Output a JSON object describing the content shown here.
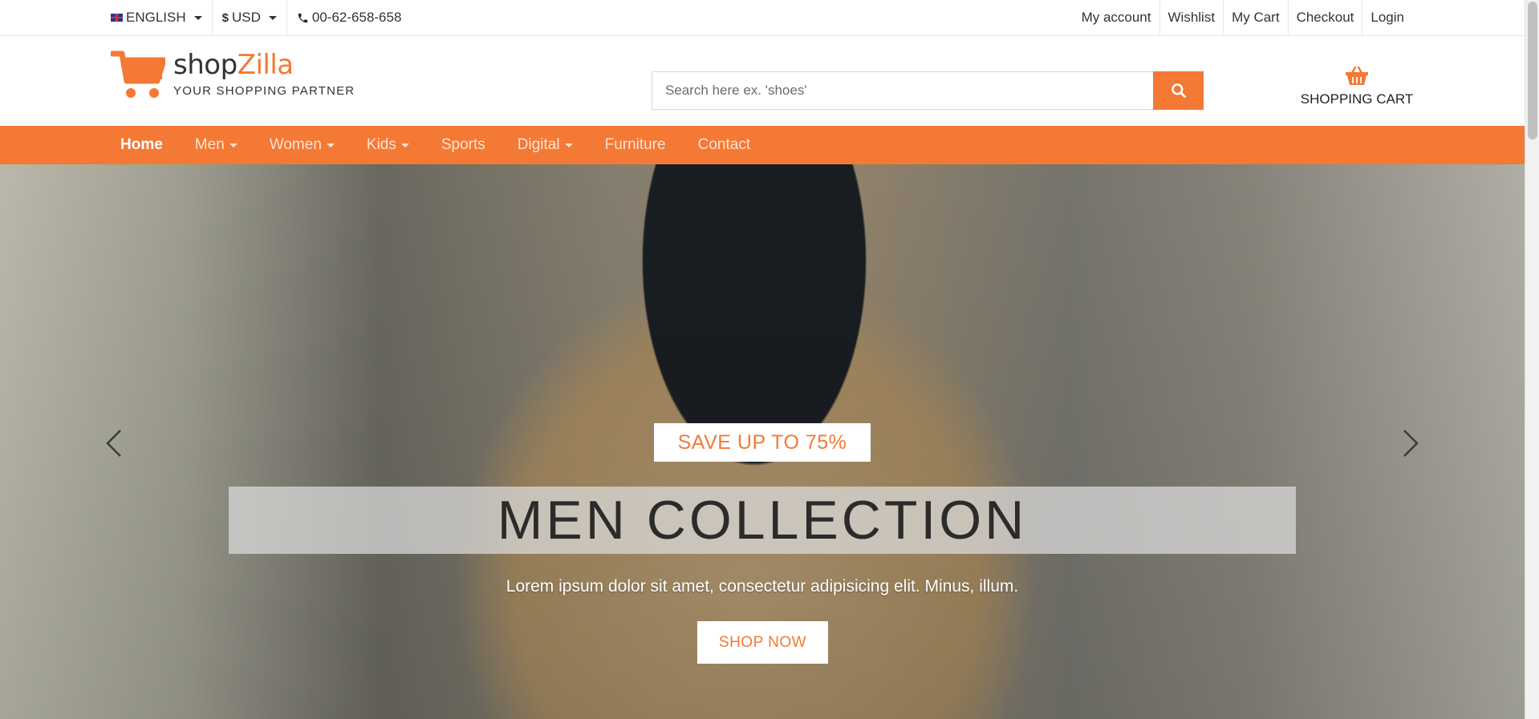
{
  "topbar": {
    "language": "ENGLISH",
    "currency": "USD",
    "phone": "00-62-658-658",
    "links": [
      "My account",
      "Wishlist",
      "My Cart",
      "Checkout",
      "Login"
    ]
  },
  "header": {
    "logo_name_part1": "shop",
    "logo_name_part2": "Zilla",
    "logo_tagline": "YOUR SHOPPING PARTNER",
    "search_placeholder": "Search here ex. 'shoes'",
    "cart_label": "SHOPPING CART"
  },
  "nav": {
    "items": [
      {
        "label": "Home"
      },
      {
        "label": "Men"
      },
      {
        "label": "Women"
      },
      {
        "label": "Kids"
      },
      {
        "label": "Sports"
      },
      {
        "label": "Digital"
      },
      {
        "label": "Furniture"
      },
      {
        "label": "Contact"
      }
    ]
  },
  "hero": {
    "badge": "SAVE UP TO 75%",
    "title": "MEN COLLECTION",
    "description": "Lorem ipsum dolor sit amet, consectetur adipisicing elit. Minus, illum.",
    "button": "SHOP NOW"
  },
  "colors": {
    "accent": "#f37935",
    "text": "#333333"
  }
}
